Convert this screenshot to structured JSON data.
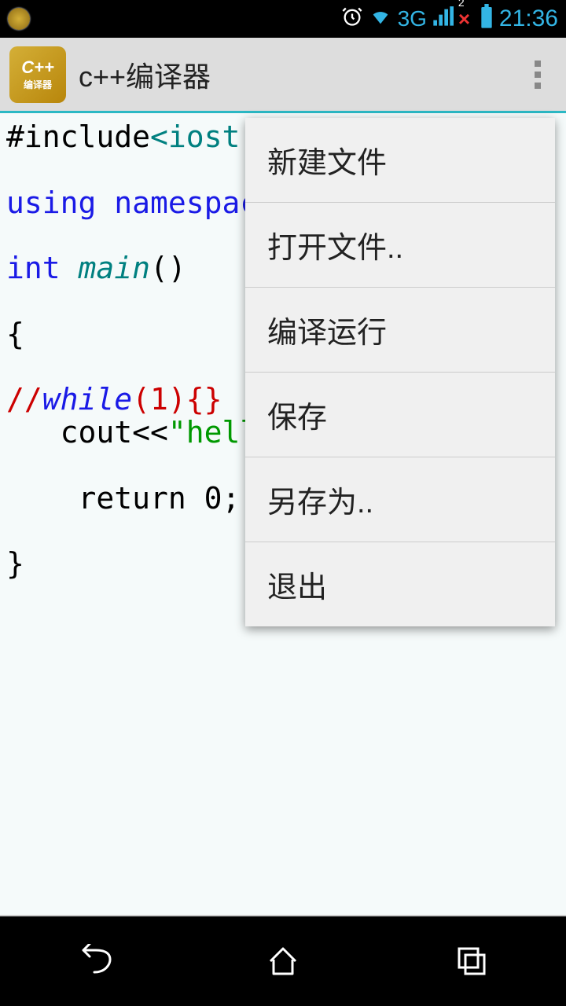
{
  "status_bar": {
    "network_label": "3G",
    "sim_x": "×",
    "clock": "21:36",
    "sim_num": "2"
  },
  "app_bar": {
    "icon_top": "C++",
    "icon_bottom": "编译器",
    "title": "c++编译器"
  },
  "editor": {
    "code_tokens": {
      "include": "#include",
      "iostream": "<iostr",
      "using": "using ",
      "namespace": "namespac",
      "int": "int ",
      "main": "main",
      "parens": "()",
      "lbrace": "{",
      "comment_slash": "//",
      "while": "while",
      "while_args": "(1){}",
      "cout": "   cout<<",
      "string": "\"hell",
      "return": "    return 0;",
      "rbrace": "}"
    }
  },
  "menu": {
    "items": [
      "新建文件",
      "打开文件..",
      "编译运行",
      "保存",
      "另存为..",
      "退出"
    ]
  }
}
